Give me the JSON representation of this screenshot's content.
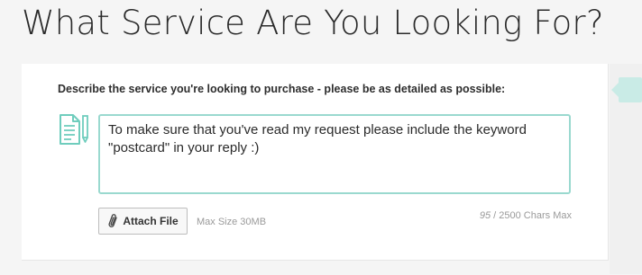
{
  "page": {
    "title": "What Service Are You Looking For?"
  },
  "form": {
    "label": "Describe the service you're looking to purchase - please be as detailed as possible:",
    "description_value": "To make sure that you've read my request please include the keyword \"postcard\" in your reply :)",
    "attach_label": "Attach File",
    "max_size": "Max Size 30MB",
    "char_count": {
      "used": "95",
      "suffix": "/ 2500 Chars Max"
    }
  },
  "colors": {
    "accent": "#9ad9cf",
    "icon": "#6fcdbd",
    "side_highlight": "#c9ebe6"
  },
  "icons": {
    "document": "document-icon",
    "attach": "paperclip-icon"
  }
}
